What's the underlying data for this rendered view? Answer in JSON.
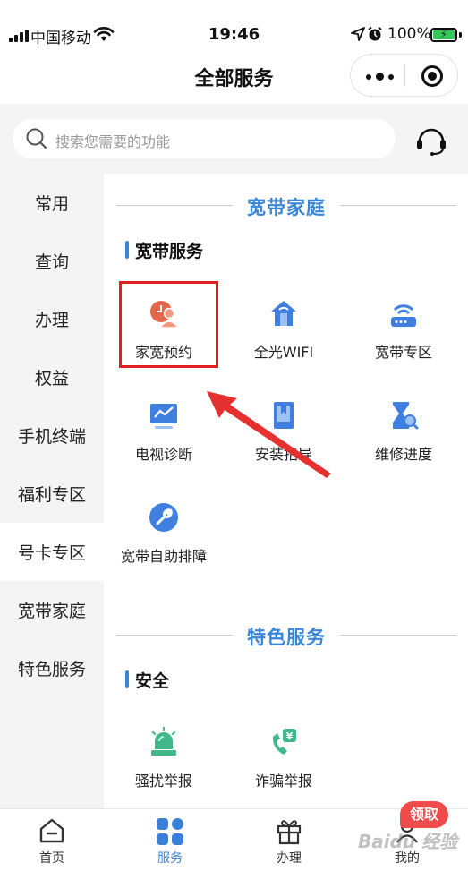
{
  "status_bar": {
    "carrier": "中国移动",
    "time": "19:46",
    "battery": "100%"
  },
  "header": {
    "title": "全部服务"
  },
  "search": {
    "placeholder": "搜索您需要的功能"
  },
  "sidebar": {
    "items": [
      {
        "label": "常用"
      },
      {
        "label": "查询"
      },
      {
        "label": "办理"
      },
      {
        "label": "权益"
      },
      {
        "label": "手机终端"
      },
      {
        "label": "福利专区"
      },
      {
        "label": "号卡专区"
      },
      {
        "label": "宽带家庭"
      },
      {
        "label": "特色服务"
      }
    ],
    "active_index": 6
  },
  "sections": [
    {
      "title": "宽带家庭",
      "subtitle": "宽带服务",
      "items": [
        {
          "label": "家宽预约",
          "icon": "person-clock-icon",
          "color": "#e4664a"
        },
        {
          "label": "全光WIFI",
          "icon": "home-wifi-icon",
          "color": "#3f7fe0"
        },
        {
          "label": "宽带专区",
          "icon": "router-icon",
          "color": "#3f7fe0"
        },
        {
          "label": "电视诊断",
          "icon": "tv-chart-icon",
          "color": "#3f7fe0"
        },
        {
          "label": "安装指导",
          "icon": "book-icon",
          "color": "#3f7fe0"
        },
        {
          "label": "维修进度",
          "icon": "hourglass-search-icon",
          "color": "#3f7fe0"
        },
        {
          "label": "宽带自助排障",
          "icon": "wrench-icon",
          "color": "#3f7fe0"
        }
      ]
    },
    {
      "title": "特色服务",
      "subtitle": "安全",
      "items": [
        {
          "label": "骚扰举报",
          "icon": "alarm-siren-icon",
          "color": "#3fb88a"
        },
        {
          "label": "诈骗举报",
          "icon": "phone-money-icon",
          "color": "#3fb88a"
        }
      ]
    }
  ],
  "tabbar": {
    "items": [
      {
        "label": "首页",
        "icon": "home-icon"
      },
      {
        "label": "服务",
        "icon": "grid-icon"
      },
      {
        "label": "办理",
        "icon": "gift-icon"
      },
      {
        "label": "我的",
        "icon": "user-icon"
      }
    ],
    "active_index": 1,
    "badge": "领取"
  },
  "watermark": "Baidu 经验",
  "colors": {
    "accent": "#3a86d6",
    "highlight": "#e02020",
    "arrow": "#e53030"
  }
}
